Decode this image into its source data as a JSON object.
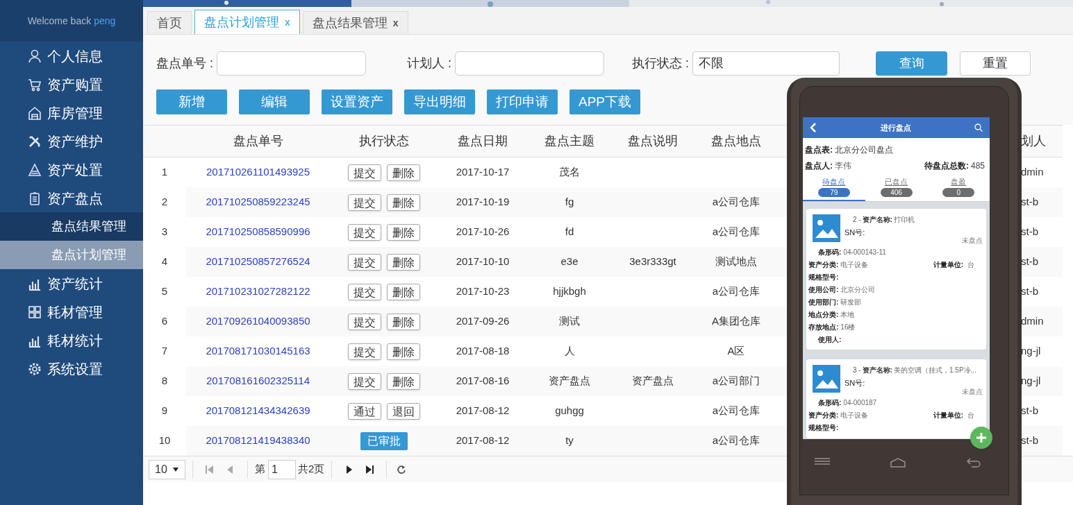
{
  "sidebar": {
    "welcome": "Welcome back",
    "user": "peng",
    "items": [
      {
        "label": "个人信息",
        "selected": false
      },
      {
        "label": "资产购置",
        "selected": false
      },
      {
        "label": "库房管理",
        "selected": false
      },
      {
        "label": "资产维护",
        "selected": false
      },
      {
        "label": "资产处置",
        "selected": false
      },
      {
        "label": "资产盘点",
        "selected": false,
        "children": [
          {
            "label": "盘点结果管理",
            "selected": false
          },
          {
            "label": "盘点计划管理",
            "selected": true
          }
        ]
      },
      {
        "label": "资产统计",
        "selected": false
      },
      {
        "label": "耗材管理",
        "selected": false
      },
      {
        "label": "耗材统计",
        "selected": false
      },
      {
        "label": "系统设置",
        "selected": false
      }
    ]
  },
  "tabs": [
    {
      "label": "首页",
      "selected": false
    },
    {
      "label": "盘点计划管理",
      "selected": true,
      "close": "x"
    },
    {
      "label": "盘点结果管理",
      "selected": false,
      "close": "x"
    }
  ],
  "filters": [
    {
      "label": "盘点单号 :",
      "kind": "text"
    },
    {
      "label": "计划人 :",
      "kind": "text"
    },
    {
      "label": "执行状态 :",
      "kind": "select",
      "value": "不限"
    }
  ],
  "search_buttons": [
    "查询",
    "重置"
  ],
  "actions": [
    "新增",
    "编辑",
    "设置资产",
    "导出明细",
    "打印申请",
    "APP下载"
  ],
  "table": {
    "columns": [
      "盘点单号",
      "执行状态",
      "盘点日期",
      "盘点主题",
      "盘点说明",
      "盘点地点",
      "划人"
    ],
    "rows": [
      {
        "index": "1",
        "number": "201710261101493925",
        "status": {
          "kind": "buttons",
          "buttons": [
            "提交",
            "删除"
          ]
        },
        "date": "2017-10-17",
        "subject": "茂名",
        "planner": "dmin"
      },
      {
        "index": "2",
        "number": "201710250859223245",
        "status": {
          "kind": "buttons",
          "buttons": [
            "提交",
            "删除"
          ]
        },
        "date": "2017-10-19",
        "subject": "fg",
        "location": "a公司仓库",
        "planner": "st-b"
      },
      {
        "index": "3",
        "number": "201710250858590996",
        "status": {
          "kind": "buttons",
          "buttons": [
            "提交",
            "删除"
          ]
        },
        "date": "2017-10-26",
        "subject": "fd",
        "location": "a公司仓库",
        "planner": "st-b"
      },
      {
        "index": "4",
        "number": "201710250857276524",
        "status": {
          "kind": "buttons",
          "buttons": [
            "提交",
            "删除"
          ]
        },
        "date": "2017-10-10",
        "subject": "e3e",
        "note": "3e3r333gt",
        "location": "测试地点",
        "planner": "st-b"
      },
      {
        "index": "5",
        "number": "201710231027282122",
        "status": {
          "kind": "buttons",
          "buttons": [
            "提交",
            "删除"
          ]
        },
        "date": "2017-10-23",
        "subject": "hjjkbgh",
        "location": "a公司仓库",
        "planner": "st-b"
      },
      {
        "index": "6",
        "number": "201709261040093850",
        "status": {
          "kind": "buttons",
          "buttons": [
            "提交",
            "删除"
          ]
        },
        "date": "2017-09-26",
        "subject": "测试",
        "location": "A集团仓库",
        "planner": "dmin"
      },
      {
        "index": "7",
        "number": "201708171030145163",
        "status": {
          "kind": "buttons",
          "buttons": [
            "提交",
            "删除"
          ]
        },
        "date": "2017-08-18",
        "subject": "人",
        "location": "A区",
        "planner": "ng-jl"
      },
      {
        "index": "8",
        "number": "201708161602325114",
        "status": {
          "kind": "buttons",
          "buttons": [
            "提交",
            "删除"
          ]
        },
        "date": "2017-08-16",
        "subject": "资产盘点",
        "note": "资产盘点",
        "location": "a公司部门",
        "planner": "ng-jl"
      },
      {
        "index": "9",
        "number": "201708121434342639",
        "status": {
          "kind": "buttons",
          "buttons": [
            "通过",
            "退回"
          ]
        },
        "date": "2017-08-12",
        "subject": "guhgg",
        "location": "a公司仓库",
        "planner": "st-b"
      },
      {
        "index": "10",
        "number": "201708121419438340",
        "status": {
          "kind": "badge",
          "text": "已审批"
        },
        "date": "2017-08-12",
        "subject": "ty",
        "location": "a公司仓库",
        "planner": "st-b"
      }
    ]
  },
  "pager": {
    "page_size": "10",
    "page_prefix": "第",
    "page": "1",
    "total": "共2页"
  },
  "phone": {
    "title": "进行盘点",
    "sheet_label": "盘点表:",
    "sheet": "北京分公司盘点",
    "person_label": "盘点人:",
    "person": "李伟",
    "pending_label": "待盘点总数:",
    "pending": "485",
    "tabs": [
      {
        "label": "待盘点",
        "count": "79",
        "selected": true
      },
      {
        "label": "已盘点",
        "count": "406",
        "selected": false
      },
      {
        "label": "盘盈",
        "count": "0",
        "selected": false
      }
    ],
    "cards": [
      {
        "prefix": "2 - ",
        "name_label": "资产名称:",
        "name": "打印机",
        "sn_label": "SN号:",
        "state": "未盘点",
        "fields": [
          {
            "label": "条形码:",
            "value": "04-000143-11",
            "indent": true
          },
          {
            "label": "资产分类:",
            "value": "电子设备",
            "extra_label": "计量单位:",
            "extra_value": "台"
          },
          {
            "label": "规格型号:"
          },
          {
            "label": "使用公司:",
            "value": "北京分公司"
          },
          {
            "label": "使用部门:",
            "value": "研发部"
          },
          {
            "label": "地点分类:",
            "value": "本地"
          },
          {
            "label": "存放地点:",
            "value": "16楼"
          },
          {
            "label": "使用人:",
            "indent": true
          }
        ]
      },
      {
        "prefix": "3 - ",
        "name_label": "资产名称:",
        "name": "美的空调（挂式，1.5P冷...",
        "sn_label": "SN号:",
        "state": "未盘点",
        "fields": [
          {
            "label": "条形码:",
            "value": "04-000187",
            "indent": true
          },
          {
            "label": "资产分类:",
            "value": "电子设备",
            "extra_label": "计量单位:",
            "extra_value": "台"
          },
          {
            "label": "规格型号:"
          }
        ]
      }
    ]
  }
}
